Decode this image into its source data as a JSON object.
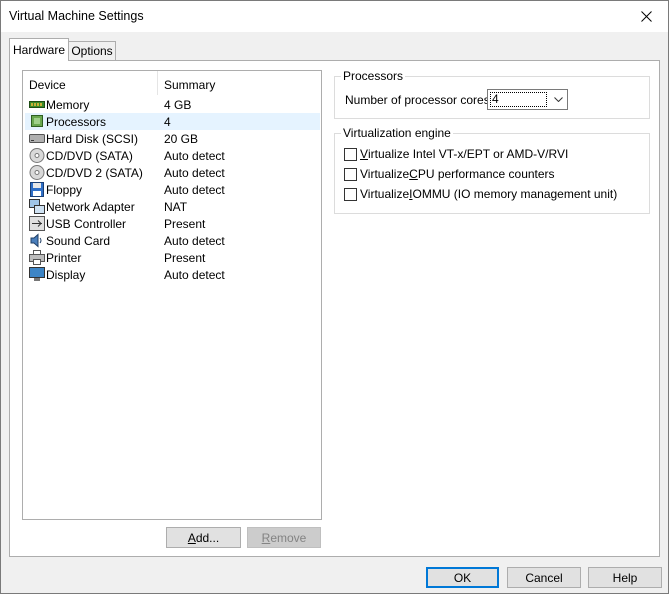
{
  "window": {
    "title": "Virtual Machine Settings"
  },
  "tabs": [
    {
      "label": "Hardware",
      "active": true
    },
    {
      "label": "Options",
      "active": false
    }
  ],
  "device_list": {
    "columns": {
      "device": "Device",
      "summary": "Summary"
    },
    "rows": [
      {
        "name": "Memory",
        "summary": "4 GB",
        "icon": "memory-icon",
        "selected": false
      },
      {
        "name": "Processors",
        "summary": "4",
        "icon": "processor-icon",
        "selected": true
      },
      {
        "name": "Hard Disk (SCSI)",
        "summary": "20 GB",
        "icon": "hard-disk-icon",
        "selected": false
      },
      {
        "name": "CD/DVD (SATA)",
        "summary": "Auto detect",
        "icon": "cd-dvd-icon",
        "selected": false
      },
      {
        "name": "CD/DVD 2 (SATA)",
        "summary": "Auto detect",
        "icon": "cd-dvd-icon",
        "selected": false
      },
      {
        "name": "Floppy",
        "summary": "Auto detect",
        "icon": "floppy-icon",
        "selected": false
      },
      {
        "name": "Network Adapter",
        "summary": "NAT",
        "icon": "network-adapter-icon",
        "selected": false
      },
      {
        "name": "USB Controller",
        "summary": "Present",
        "icon": "usb-icon",
        "selected": false
      },
      {
        "name": "Sound Card",
        "summary": "Auto detect",
        "icon": "sound-card-icon",
        "selected": false
      },
      {
        "name": "Printer",
        "summary": "Present",
        "icon": "printer-icon",
        "selected": false
      },
      {
        "name": "Display",
        "summary": "Auto detect",
        "icon": "display-icon",
        "selected": false
      }
    ]
  },
  "list_buttons": {
    "add": {
      "pre": "",
      "key": "A",
      "post": "dd...",
      "enabled": true
    },
    "remove": {
      "pre": "",
      "key": "R",
      "post": "emove",
      "enabled": false
    }
  },
  "processors": {
    "legend": "Processors",
    "cores_label": "Number of processor cores:",
    "cores_value": "4"
  },
  "virtualization": {
    "legend": "Virtualization engine",
    "options": [
      {
        "pre": "",
        "key": "V",
        "post": "irtualize Intel VT-x/EPT or AMD-V/RVI",
        "checked": false
      },
      {
        "pre": "Virtualize ",
        "key": "C",
        "post": "PU performance counters",
        "checked": false
      },
      {
        "pre": "Virtualize ",
        "key": "I",
        "post": "OMMU (IO memory management unit)",
        "checked": false
      }
    ]
  },
  "dialog_buttons": {
    "ok": "OK",
    "cancel": "Cancel",
    "help": "Help"
  },
  "colors": {
    "accent": "#0078d7",
    "selection": "#e5f3ff"
  }
}
